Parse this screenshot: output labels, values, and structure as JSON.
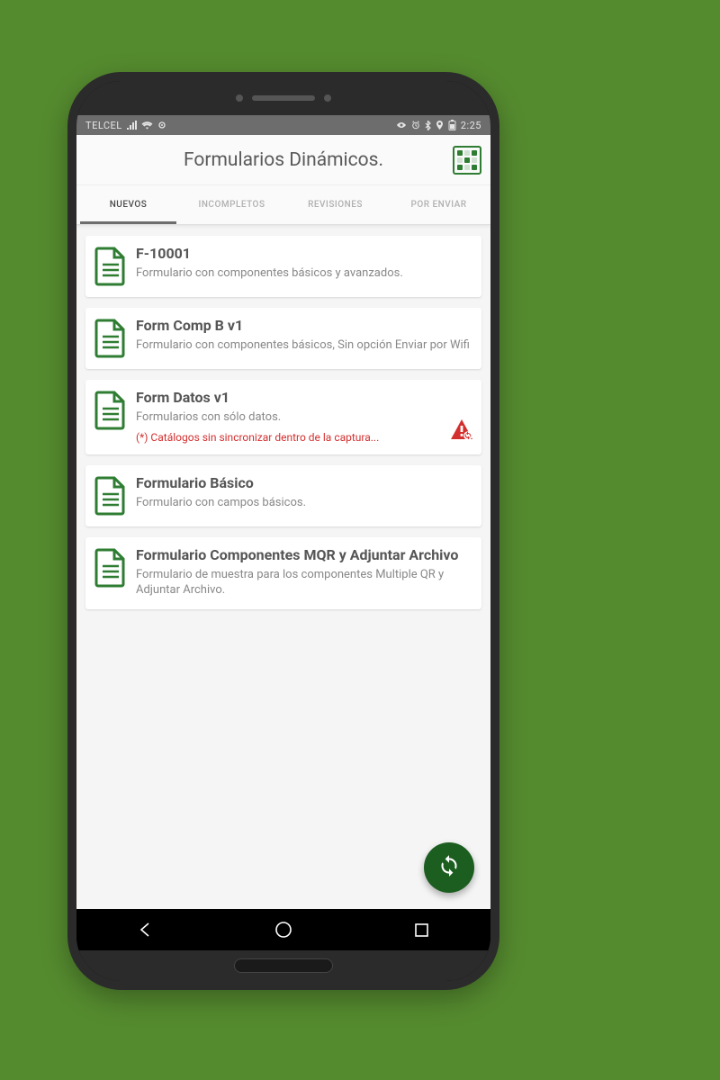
{
  "statusbar": {
    "carrier": "TELCEL",
    "time": "2:25"
  },
  "appbar": {
    "title": "Formularios Dinámicos."
  },
  "tabs": [
    {
      "label": "NUEVOS",
      "active": true
    },
    {
      "label": "INCOMPLETOS",
      "active": false
    },
    {
      "label": "REVISIONES",
      "active": false
    },
    {
      "label": "POR ENVIAR",
      "active": false
    }
  ],
  "forms": [
    {
      "title": "F-10001",
      "desc": "Formulario con componentes básicos y avanzados.",
      "warning": null,
      "alert": false
    },
    {
      "title": "Form Comp B v1",
      "desc": "Formulario con componentes básicos, Sin opción Enviar por Wifi",
      "warning": null,
      "alert": false
    },
    {
      "title": "Form Datos v1",
      "desc": "Formularios con sólo datos.",
      "warning": "(*) Catálogos sin sincronizar dentro de la captura...",
      "alert": true
    },
    {
      "title": "Formulario Básico",
      "desc": "Formulario con campos básicos.",
      "warning": null,
      "alert": false
    },
    {
      "title": "Formulario Componentes MQR y Adjuntar Archivo",
      "desc": "Formulario de muestra para los componentes Multiple QR y Adjuntar Archivo.",
      "warning": null,
      "alert": false
    }
  ],
  "colors": {
    "brand_green": "#2e7d32",
    "danger": "#d32f2f",
    "fab": "#1b5e20",
    "bg": "#558b2f"
  }
}
